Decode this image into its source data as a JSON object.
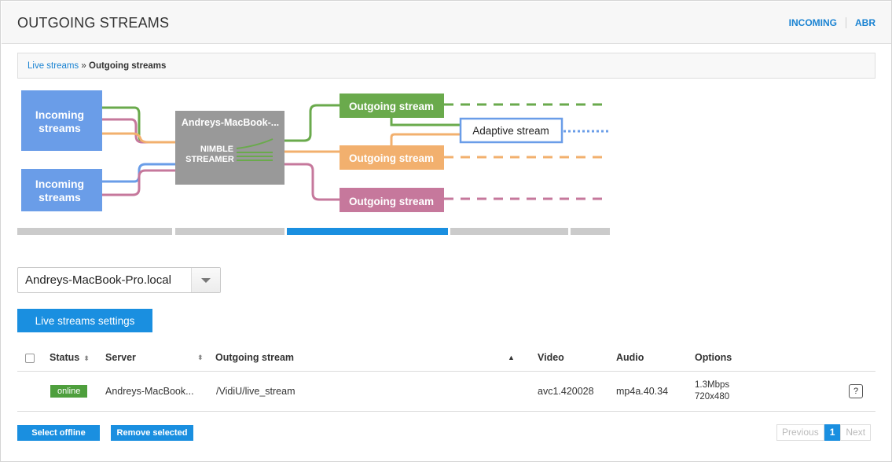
{
  "header": {
    "title": "OUTGOING STREAMS",
    "links": [
      "INCOMING",
      "ABR"
    ]
  },
  "breadcrumb": {
    "parent": "Live streams",
    "separator": "»",
    "current": "Outgoing streams"
  },
  "diagram": {
    "incoming_1": [
      "Incoming",
      "streams"
    ],
    "incoming_2": [
      "Incoming",
      "streams"
    ],
    "server_name": "Andreys-MacBook-...",
    "logo": [
      "NIMBLE",
      "STREAMER"
    ],
    "outgoing_1": "Outgoing stream",
    "outgoing_2": "Outgoing stream",
    "outgoing_3": "Outgoing stream",
    "adaptive": "Adaptive stream",
    "colors": {
      "green": "#6aaa4c",
      "orange": "#f2b06e",
      "pink": "#c6789c",
      "blue": "#6a9de8",
      "gray": "#999999",
      "accent": "#1a8fe0"
    }
  },
  "server_select": {
    "value": "Andreys-MacBook-Pro.local"
  },
  "settings_button": "Live streams settings",
  "table": {
    "headers": {
      "status": "Status",
      "server": "Server",
      "outgoing_stream": "Outgoing stream",
      "video": "Video",
      "audio": "Audio",
      "options": "Options"
    },
    "rows": [
      {
        "status": "online",
        "server": "Andreys-MacBook...",
        "stream": "/VidiU/live_stream",
        "video": "avc1.420028",
        "audio": "mp4a.40.34",
        "bitrate": "1.3Mbps",
        "resolution": "720x480",
        "help": "?"
      }
    ]
  },
  "footer": {
    "select_offline": "Select offline",
    "remove_selected": "Remove selected"
  },
  "pagination": {
    "previous": "Previous",
    "page": "1",
    "next": "Next"
  }
}
